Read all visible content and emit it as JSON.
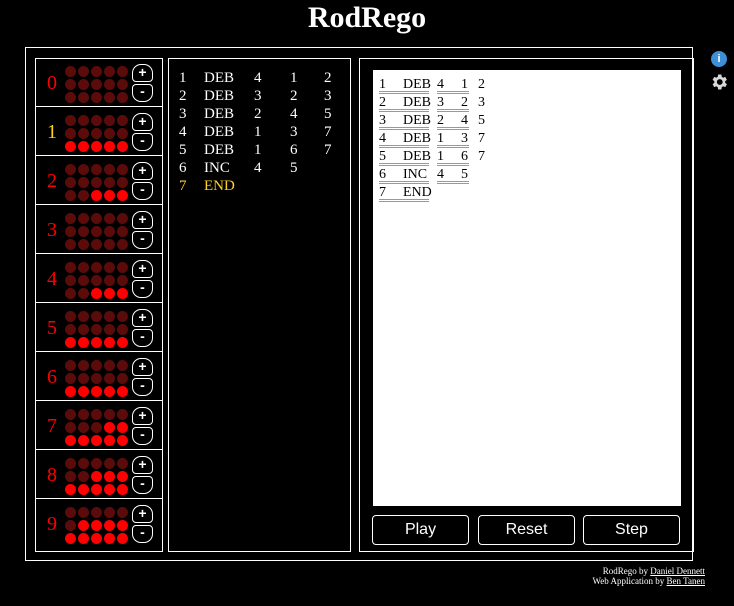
{
  "app": {
    "title": "RodRego"
  },
  "colors": {
    "bead_on": "#ff0000",
    "bead_off": "#5c0b0b",
    "register_number": "#ff0000",
    "current_register": "#ffd21f",
    "current_line": "#ffd21f",
    "info": "#3d8fd8"
  },
  "registers": [
    {
      "number": "0",
      "value": 0,
      "current": false
    },
    {
      "number": "1",
      "value": 5,
      "current": true
    },
    {
      "number": "2",
      "value": 3,
      "current": false
    },
    {
      "number": "3",
      "value": 0,
      "current": false
    },
    {
      "number": "4",
      "value": 3,
      "current": false
    },
    {
      "number": "5",
      "value": 5,
      "current": false
    },
    {
      "number": "6",
      "value": 5,
      "current": false
    },
    {
      "number": "7",
      "value": 7,
      "current": false
    },
    {
      "number": "8",
      "value": 8,
      "current": false
    },
    {
      "number": "9",
      "value": 9,
      "current": false
    }
  ],
  "register_controls": {
    "plus_label": "+",
    "minus_label": "-"
  },
  "program": [
    {
      "line": "1",
      "op": "DEB",
      "reg": "4",
      "a": "1",
      "b": "2",
      "current": false
    },
    {
      "line": "2",
      "op": "DEB",
      "reg": "3",
      "a": "2",
      "b": "3",
      "current": false
    },
    {
      "line": "3",
      "op": "DEB",
      "reg": "2",
      "a": "4",
      "b": "5",
      "current": false
    },
    {
      "line": "4",
      "op": "DEB",
      "reg": "1",
      "a": "3",
      "b": "7",
      "current": false
    },
    {
      "line": "5",
      "op": "DEB",
      "reg": "1",
      "a": "6",
      "b": "7",
      "current": false
    },
    {
      "line": "6",
      "op": "INC",
      "reg": "4",
      "a": "5",
      "b": "",
      "current": false
    },
    {
      "line": "7",
      "op": "END",
      "reg": "",
      "a": "",
      "b": "",
      "current": true
    }
  ],
  "editor": {
    "lines": [
      {
        "line": "1",
        "op": "DEB",
        "reg": "4",
        "a": "1",
        "b": "2"
      },
      {
        "line": "2",
        "op": "DEB",
        "reg": "3",
        "a": "2",
        "b": "3"
      },
      {
        "line": "3",
        "op": "DEB",
        "reg": "2",
        "a": "4",
        "b": "5"
      },
      {
        "line": "4",
        "op": "DEB",
        "reg": "1",
        "a": "3",
        "b": "7"
      },
      {
        "line": "5",
        "op": "DEB",
        "reg": "1",
        "a": "6",
        "b": "7"
      },
      {
        "line": "6",
        "op": "INC",
        "reg": "4",
        "a": "5",
        "b": ""
      },
      {
        "line": "7",
        "op": "END",
        "reg": "",
        "a": "",
        "b": ""
      }
    ]
  },
  "controls": {
    "play": "Play",
    "reset": "Reset",
    "step": "Step"
  },
  "icons": {
    "info": "i",
    "info_name": "info-icon",
    "settings_name": "gear-icon"
  },
  "credits": {
    "line1_prefix": "RodRego by",
    "line1_author": "Daniel Dennett",
    "line2_prefix": "Web Application by",
    "line2_author": "Ben Tanen"
  }
}
